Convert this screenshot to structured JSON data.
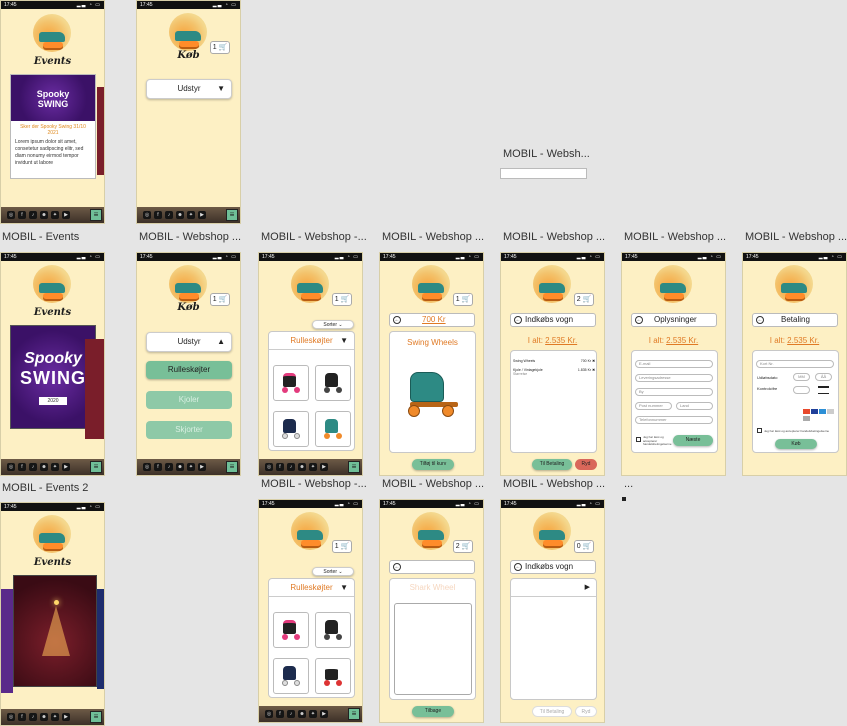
{
  "status": {
    "time": "17:45"
  },
  "frames": {
    "events_top": {
      "title": "Events",
      "card_caption": "Sker der Spooky Swing 31/10 2021",
      "card_body": "Lorem ipsum dolor sit amet, consetetur sadipscing elitr, sed diam nonumy eirmod tempor invidunt ut labore"
    },
    "webshop_top": {
      "title": "Køb",
      "cart_count": "1",
      "dropdown": "Udstyr"
    },
    "webshop_empty": {
      "label": "MOBIL - Websh..."
    },
    "events": {
      "label": "MOBIL - Events",
      "title": "Events",
      "poster_line1": "Spooky",
      "poster_line2": "SWING",
      "poster_year": "2020"
    },
    "webshop_menu": {
      "label": "MOBIL - Webshop ...",
      "title": "Køb",
      "cart_count": "1",
      "dropdown": "Udstyr",
      "items": [
        "Rulleskøjter",
        "Kjoler",
        "Skjorter"
      ]
    },
    "webshop_list": {
      "label": "MOBIL - Webshop -...",
      "cart_count": "1",
      "sort": "Sorter",
      "category": "Rulleskøjter"
    },
    "webshop_product": {
      "label": "MOBIL - Webshop ...",
      "cart_count": "1",
      "price": "700 Kr",
      "product": "Swing Wheels",
      "add_button": "Tilføj til kurv"
    },
    "webshop_cart": {
      "label": "MOBIL - Webshop ...",
      "cart_count": "2",
      "header": "Indkøbs vogn",
      "total_label": "I alt:",
      "total_value": "2.535 Kr.",
      "rows": [
        {
          "name": "Swing Wheels",
          "price": "700 Kr"
        },
        {
          "name": "Kjole / Vintagekjole",
          "sub": "Størrelse",
          "price": "1.835 Kr"
        }
      ],
      "pay_button": "Til Betaling",
      "clear_button": "Ryd"
    },
    "webshop_info": {
      "label": "MOBIL - Webshop ...",
      "header": "Oplysninger",
      "total_label": "I alt:",
      "total_value": "2.535 Kr.",
      "fields": [
        "E-mail",
        "Leveringsadresse",
        "By",
        "Post nummer",
        "Land",
        "Telefonnummer"
      ],
      "checkbox": "Jeg har læst og accepterer handelsbetingelserne",
      "next_button": "Næste"
    },
    "webshop_pay": {
      "label": "MOBIL - Webshop ...",
      "header": "Betaling",
      "total_label": "I alt:",
      "total_value": "2.535 Kr.",
      "card_field": "Kort Nr.",
      "expiry_label": "Udløbsdato",
      "month": "MM",
      "year": "ÅÅ",
      "cvc_label": "Kontrolcifre",
      "checkbox": "Jeg har læst og accepterer handelsbetingelserne",
      "buy_button": "Køb"
    },
    "events2": {
      "label": "MOBIL - Events 2"
    },
    "webshop_list2": {
      "label": "MOBIL - Webshop -...",
      "cart_count": "1",
      "sort": "Sorter",
      "category": "Rulleskøjter"
    },
    "webshop_product2": {
      "label": "MOBIL - Webshop ...",
      "cart_count": "2",
      "product": "Shark Wheel",
      "back_button": "Tilbage"
    },
    "webshop_cart2": {
      "label": "MOBIL - Webshop ...",
      "cart_count": "0",
      "header": "Indkøbs vogn",
      "pay_button": "Til Betaling",
      "clear_button": "Ryd"
    },
    "ellipsis": {
      "label": "..."
    }
  }
}
